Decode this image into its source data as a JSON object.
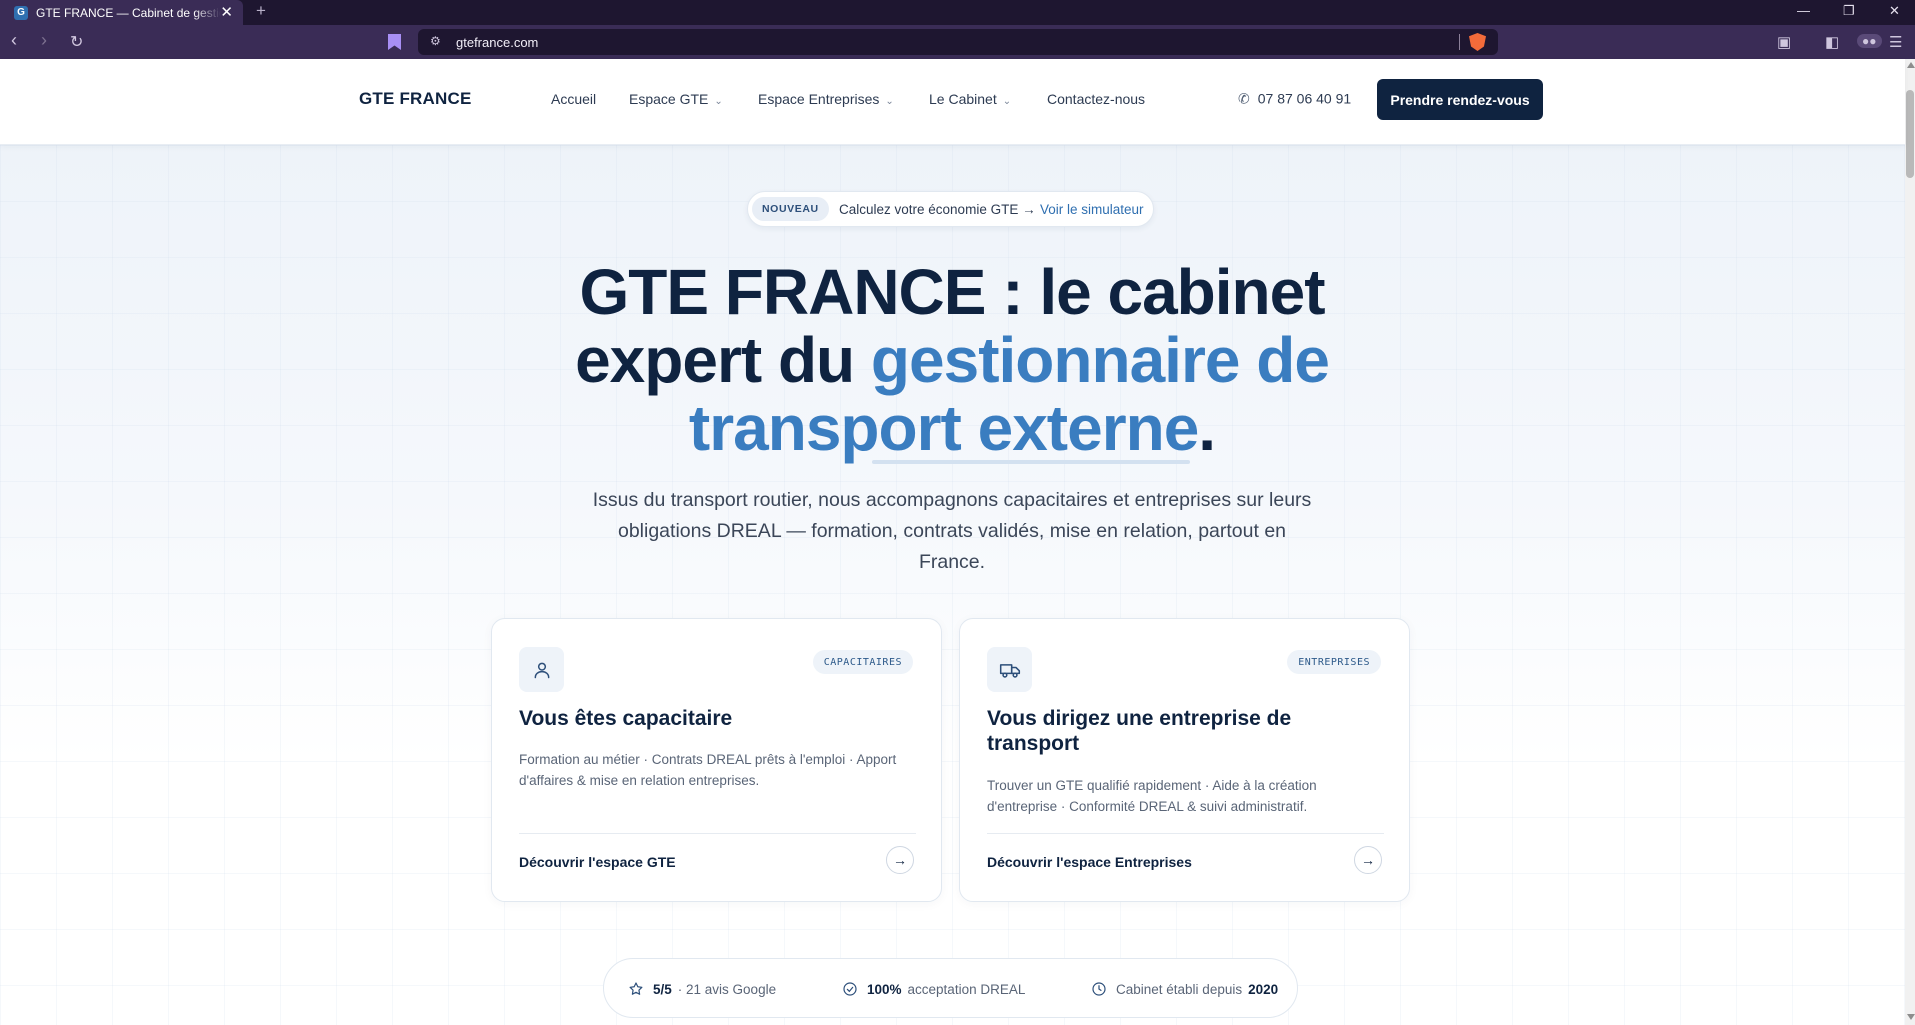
{
  "browser": {
    "tab_title": "GTE FRANCE — Cabinet de gestion",
    "favicon_letter": "G",
    "url": "gtefrance.com",
    "icons": [
      "back-icon",
      "forward-icon",
      "reload-icon",
      "bookmark-icon",
      "site-info-icon",
      "brave-shield-icon",
      "sidebar-icon",
      "reader-icon",
      "menu-icon"
    ]
  },
  "header": {
    "logo": "GTE FRANCE",
    "nav": [
      {
        "label": "Accueil",
        "has_dropdown": false
      },
      {
        "label": "Espace GTE",
        "has_dropdown": true
      },
      {
        "label": "Espace Entreprises",
        "has_dropdown": true
      },
      {
        "label": "Le Cabinet",
        "has_dropdown": true
      },
      {
        "label": "Contactez-nous",
        "has_dropdown": false
      }
    ],
    "phone": "07 87 06 40 91",
    "cta": "Prendre rendez-vous"
  },
  "hero": {
    "badge": "NOUVEAU",
    "announcement": "Calculez votre économie GTE →",
    "announcement_link": "Voir le simulateur",
    "title_part1": "GTE FRANCE : le cabinet expert du ",
    "title_accent": "gestionnaire de transport externe",
    "title_end": ".",
    "subtitle": "Issus du transport routier, nous accompagnons capacitaires et entreprises sur leurs obligations DREAL — formation, contrats validés, mise en relation, partout en France."
  },
  "cards": [
    {
      "tag": "CAPACITAIRES",
      "icon": "user-icon",
      "title": "Vous êtes capacitaire",
      "description": "Formation au métier · Contrats DREAL prêts à l'emploi · Apport d'affaires & mise en relation entreprises.",
      "link": "Découvrir l'espace GTE"
    },
    {
      "tag": "ENTREPRISES",
      "icon": "truck-icon",
      "title": "Vous dirigez une entreprise de transport",
      "description": "Trouver un GTE qualifié rapidement · Aide à la création d'entreprise · Conformité DREAL & suivi administratif.",
      "link": "Découvrir l'espace Entreprises"
    }
  ],
  "stats": [
    {
      "icon": "star-icon",
      "value": "5/5",
      "label": "· 21 avis Google"
    },
    {
      "icon": "check-circle-icon",
      "value": "100%",
      "label": "acceptation DREAL"
    },
    {
      "icon": "clock-icon",
      "label": "Cabinet établi depuis",
      "value": "2020"
    }
  ],
  "colors": {
    "navy": "#0f2340",
    "accent": "#3a7dc0",
    "browser_bg": "#3a2c56"
  }
}
